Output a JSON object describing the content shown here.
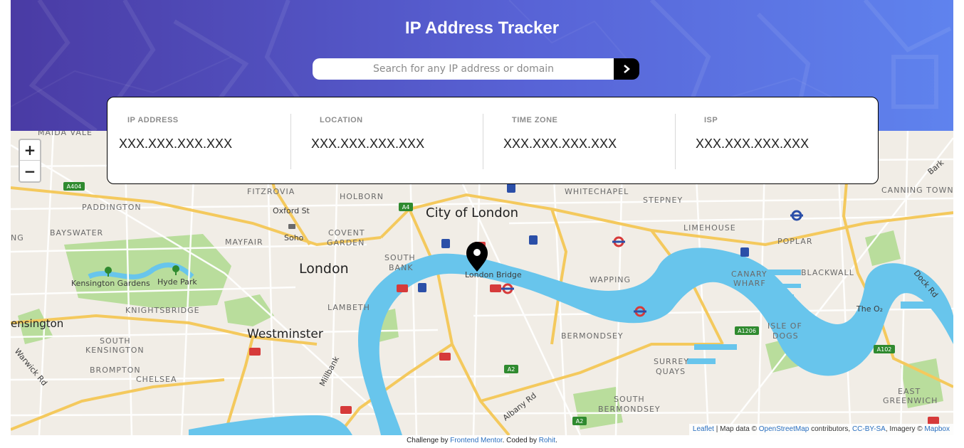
{
  "header": {
    "title": "IP Address Tracker",
    "search_placeholder": "Search for any IP address or domain",
    "search_value": "",
    "submit_icon": "chevron-right-icon"
  },
  "info": [
    {
      "label": "IP ADDRESS",
      "value": "XXX.XXX.XXX.XXX"
    },
    {
      "label": "LOCATION",
      "value": "XXX.XXX.XXX.XXX"
    },
    {
      "label": "TIME ZONE",
      "value": "XXX.XXX.XXX.XXX"
    },
    {
      "label": "ISP",
      "value": "XXX.XXX.XXX.XXX"
    }
  ],
  "map": {
    "zoom_in": "+",
    "zoom_out": "−",
    "marker_label": "London Bridge",
    "labels": {
      "maida_vale": "MAIDA VALE",
      "a404": "A404",
      "paddington": "PADDINGTON",
      "bayswater": "BAYSWATER",
      "fitzrovia": "FITZROVIA",
      "holborn": "HOLBORN",
      "a4": "A4",
      "city_of_london": "City of London",
      "whitechapel": "WHITECHAPEL",
      "stepney": "STEPNEY",
      "canning_town": "CANNING TOWN",
      "oxford_st": "Oxford St",
      "soho": "Soho",
      "covent": "COVENT",
      "garden": "GARDEN",
      "mayfair": "MAYFAIR",
      "limehouse": "LIMEHOUSE",
      "poplar": "POPLAR",
      "london": "London",
      "south": "SOUTH",
      "bank": "BANK",
      "kensington_gardens": "Kensington Gardens",
      "hyde_park": "Hyde Park",
      "wapping": "WAPPING",
      "canary": "CANARY",
      "wharf": "WHARF",
      "blackwall": "BLACKWALL",
      "dock_rd": "Dock Rd",
      "knightsbridge": "KNIGHTSBRIDGE",
      "lambeth": "LAMBETH",
      "kensington": "ensington",
      "the_o2": "The O₂",
      "westminster": "Westminster",
      "bermondsey": "BERMONDSEY",
      "isle": "ISLE OF",
      "dogs": "DOGS",
      "a1206": "A1206",
      "south_kensington_1": "SOUTH",
      "south_kensington_2": "KENSINGTON",
      "a102": "A102",
      "a2": "A2",
      "brompton": "BROMPTON",
      "surrey": "SURREY",
      "quays": "QUAYS",
      "warwick_rd": "Warwick Rd",
      "millbank": "Millbank",
      "chelsea": "CHELSEA",
      "south_bermondsey_1": "SOUTH",
      "south_bermondsey_2": "BERMONDSEY",
      "east": "EAST",
      "greenwich": "GREENWICH",
      "albany_rd": "Albany Rd",
      "bark": "Bark",
      "ng": "NG"
    }
  },
  "attribution": {
    "leaflet": "Leaflet",
    "sep1": " | Map data © ",
    "osm": "OpenStreetMap",
    "contributors": " contributors, ",
    "ccbysa": "CC-BY-SA",
    "imagery": ", Imagery © ",
    "mapbox": "Mapbox"
  },
  "footer": {
    "prefix": "Challenge by ",
    "frontend_mentor": "Frontend Mentor",
    "coded_by": ". Coded by ",
    "author": "Rohit",
    "suffix": "."
  },
  "colors": {
    "header_start": "#4a3ba4",
    "header_end": "#5f83ee",
    "water": "#68c5ec",
    "park": "#b9dd9c",
    "marker": "#000000"
  }
}
